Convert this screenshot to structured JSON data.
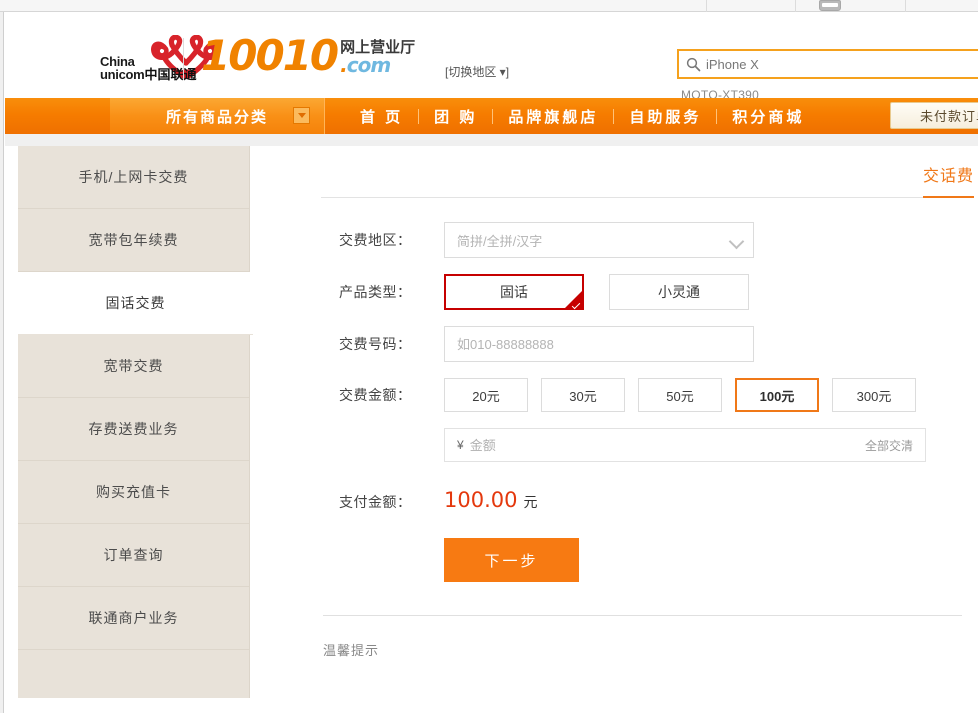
{
  "browser": {
    "icon_name": "device-icon"
  },
  "header": {
    "logo": {
      "cn_line1": "China",
      "cn_line2": "unicom",
      "cn_suffix": "中国联通",
      "mark_color": "#d8232a"
    },
    "brand": {
      "number": "10010",
      "cn_label": "网上营业厅",
      "domain_dot": ".",
      "domain": "com"
    },
    "region_switch": "[切换地区 ▾]",
    "search": {
      "placeholder": "iPhone X",
      "value": "iPhone X",
      "suggestion": "MOTO-XT390",
      "icon": "search-icon",
      "border_color": "#f5a11d"
    }
  },
  "nav": {
    "category_label": "所有商品分类",
    "links": [
      "首  页",
      "团  购",
      "品牌旗舰店",
      "自助服务",
      "积分商城"
    ],
    "unpaid_button": "未付款订单",
    "bg_color": "#f67c00"
  },
  "sidebar": {
    "items": [
      {
        "label": "手机/上网卡交费",
        "active": false
      },
      {
        "label": "宽带包年续费",
        "active": false
      },
      {
        "label": "固话交费",
        "active": true
      },
      {
        "label": "宽带交费",
        "active": false
      },
      {
        "label": "存费送费业务",
        "active": false
      },
      {
        "label": "购买充值卡",
        "active": false
      },
      {
        "label": "订单查询",
        "active": false
      },
      {
        "label": "联通商户业务",
        "active": false
      }
    ],
    "bg_color": "#e8e2d9"
  },
  "content": {
    "tab": {
      "label": "交话费",
      "color": "#f07818"
    },
    "form": {
      "region": {
        "label": "交费地区：",
        "placeholder": "简拼/全拼/汉字",
        "value": "",
        "chevron": "chevron-down-icon"
      },
      "product_type": {
        "label": "产品类型：",
        "options": [
          {
            "label": "固话",
            "selected": true
          },
          {
            "label": "小灵通",
            "selected": false
          }
        ],
        "selected_color": "#c60000"
      },
      "number": {
        "label": "交费号码：",
        "placeholder": "如010-88888888",
        "value": ""
      },
      "amount": {
        "label": "交费金额：",
        "options": [
          {
            "label": "20元",
            "selected": false
          },
          {
            "label": "30元",
            "selected": false
          },
          {
            "label": "50元",
            "selected": false
          },
          {
            "label": "100元",
            "selected": true
          },
          {
            "label": "300元",
            "selected": false
          }
        ],
        "selected_color": "#f07818"
      },
      "custom_amount": {
        "currency": "¥",
        "placeholder": "金额",
        "value": "",
        "clear_all": "全部交清"
      },
      "pay": {
        "label": "支付金额：",
        "value": "100.00",
        "unit": "元",
        "color": "#e4380d"
      },
      "next_button": {
        "label": "下一步",
        "color": "#f77a12"
      }
    },
    "tips_label": "温馨提示"
  }
}
